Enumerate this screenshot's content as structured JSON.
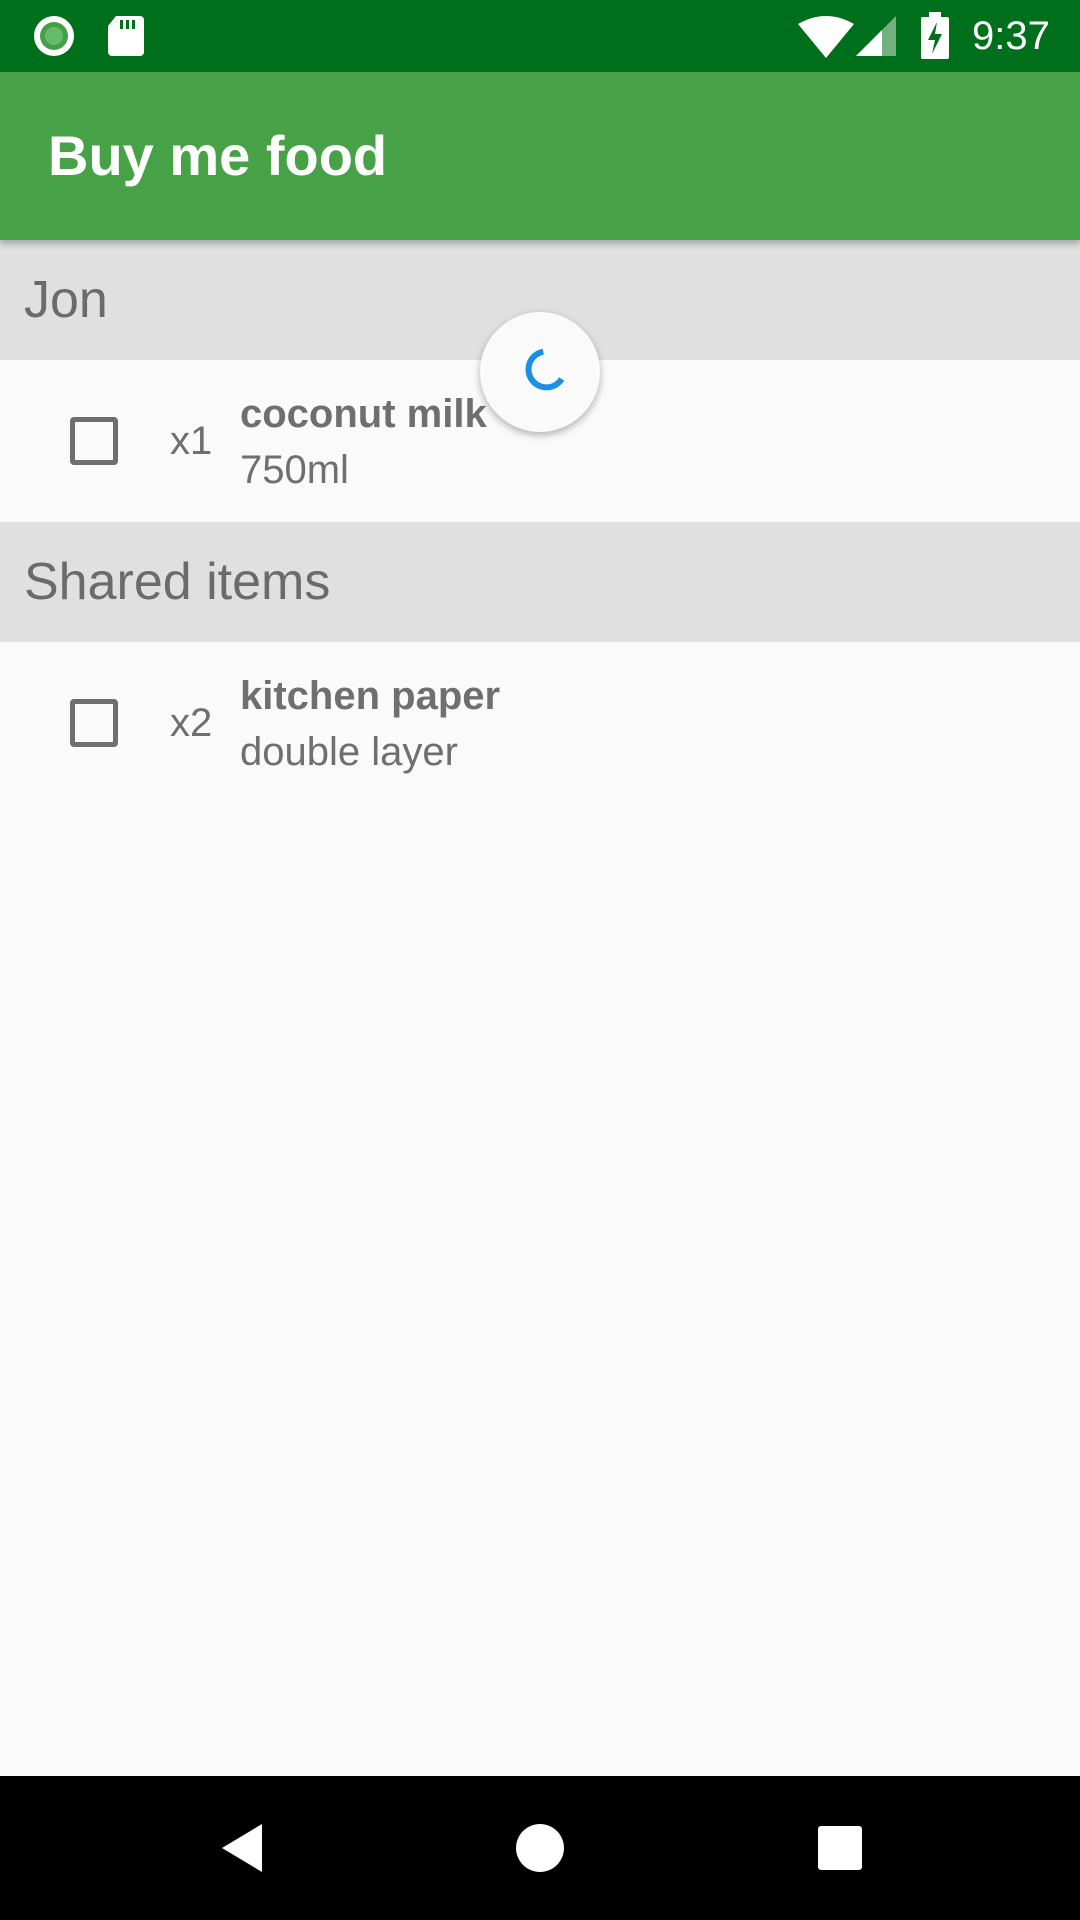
{
  "status_bar": {
    "time": "9:37",
    "icons": [
      "record-icon",
      "sd-card-icon",
      "wifi-icon",
      "cell-signal-icon",
      "battery-charging-icon"
    ]
  },
  "toolbar": {
    "title": "Buy me food"
  },
  "sections": [
    {
      "header": "Jon",
      "items": [
        {
          "quantity": "x1",
          "name": "coconut milk",
          "detail": "750ml",
          "checked": false
        }
      ]
    },
    {
      "header": "Shared items",
      "items": [
        {
          "quantity": "x2",
          "name": "kitchen paper",
          "detail": "double layer",
          "checked": false
        }
      ]
    }
  ],
  "colors": {
    "status_bar": "#006f1b",
    "toolbar": "#47a247",
    "section_header": "#e0e0e0",
    "spinner_accent": "#1a8fe3",
    "text_secondary": "#6f6f6f"
  },
  "nav_bar": {
    "buttons": [
      "back-icon",
      "home-icon",
      "recents-icon"
    ]
  }
}
